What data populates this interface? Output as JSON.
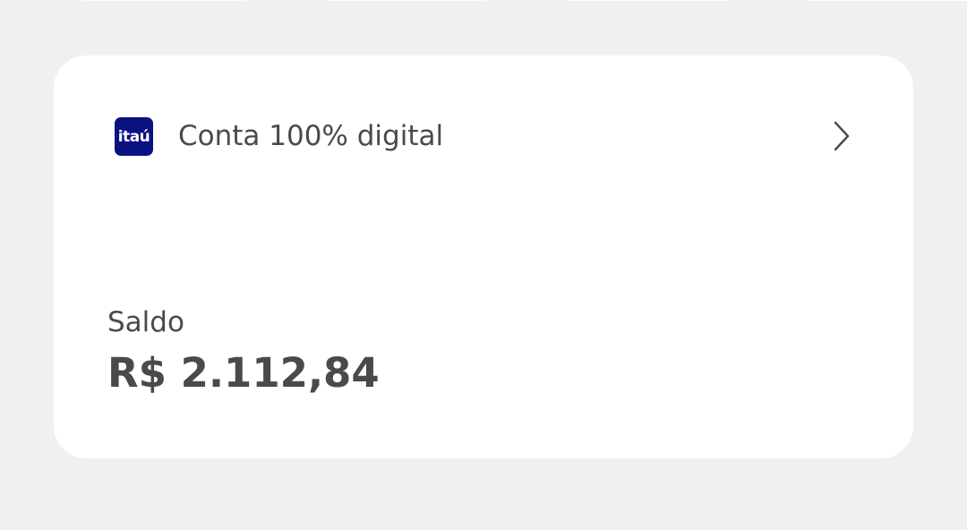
{
  "account": {
    "bank_logo_text": "itaú",
    "name": "Conta 100% digital",
    "open_icon": "chevron-right-icon"
  },
  "balance": {
    "label": "Saldo",
    "value": "R$ 2.112,84"
  },
  "colors": {
    "background": "#eff0f2",
    "card": "#ffffff",
    "brand": "#0a1180",
    "text": "#4a4a4a"
  }
}
